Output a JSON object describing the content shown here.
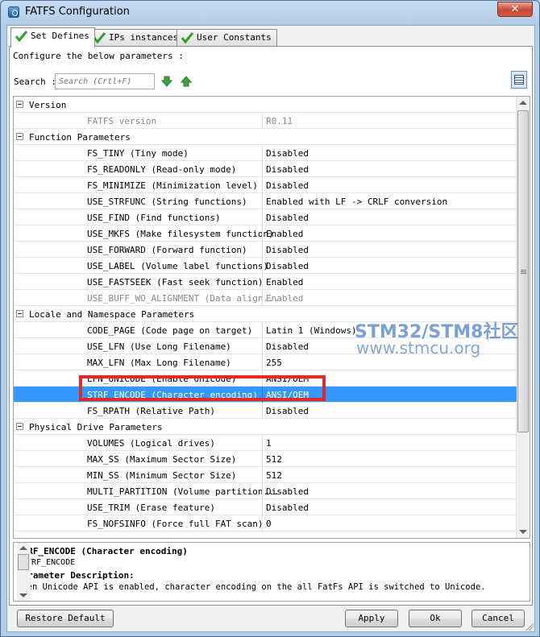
{
  "window": {
    "title": "FATFS Configuration",
    "close_label": "✕"
  },
  "tabs": [
    {
      "label": "Set Defines",
      "active": true
    },
    {
      "label": "IPs instances",
      "active": false
    },
    {
      "label": "User Constants",
      "active": false
    }
  ],
  "configure_text": "Configure the below parameters :",
  "search": {
    "label": "Search :",
    "placeholder": "Search (Crtl+F)"
  },
  "params": [
    {
      "type": "group",
      "name": "Version"
    },
    {
      "type": "param",
      "name": "FATFS version",
      "value": "R0.11",
      "disabled": true
    },
    {
      "type": "group",
      "name": "Function Parameters"
    },
    {
      "type": "param",
      "name": "FS_TINY (Tiny mode)",
      "value": "Disabled"
    },
    {
      "type": "param",
      "name": "FS_READONLY (Read-only mode)",
      "value": "Disabled"
    },
    {
      "type": "param",
      "name": "FS_MINIMIZE (Minimization level)",
      "value": "Disabled"
    },
    {
      "type": "param",
      "name": "USE_STRFUNC (String functions)",
      "value": "Enabled with LF -> CRLF conversion"
    },
    {
      "type": "param",
      "name": "USE_FIND (Find functions)",
      "value": "Disabled"
    },
    {
      "type": "param",
      "name": "USE_MKFS (Make filesystem function)",
      "value": "Enabled"
    },
    {
      "type": "param",
      "name": "USE_FORWARD (Forward function)",
      "value": "Disabled"
    },
    {
      "type": "param",
      "name": "USE_LABEL (Volume label functions)",
      "value": "Disabled"
    },
    {
      "type": "param",
      "name": "USE_FASTSEEK (Fast seek function)",
      "value": "Enabled"
    },
    {
      "type": "param",
      "name": "USE_BUFF_WO_ALIGNMENT (Data align...",
      "value": "Enabled",
      "disabled": true
    },
    {
      "type": "group",
      "name": "Locale and Namespace Parameters"
    },
    {
      "type": "param",
      "name": "CODE_PAGE (Code page on target)",
      "value": "Latin 1 (Windows)"
    },
    {
      "type": "param",
      "name": "USE_LFN (Use Long Filename)",
      "value": "Disabled"
    },
    {
      "type": "param",
      "name": "MAX_LFN (Max Long Filename)",
      "value": "255"
    },
    {
      "type": "param",
      "name": "LFN_UNICODE (Enable Unicode)",
      "value": "ANSI/OEM"
    },
    {
      "type": "param",
      "name": "STRF_ENCODE (Character encoding)",
      "value": "ANSI/OEM",
      "selected": true
    },
    {
      "type": "param",
      "name": "FS_RPATH (Relative Path)",
      "value": "Disabled"
    },
    {
      "type": "group",
      "name": "Physical Drive Parameters"
    },
    {
      "type": "param",
      "name": "VOLUMES (Logical drives)",
      "value": "1"
    },
    {
      "type": "param",
      "name": "MAX_SS (Maximum Sector Size)",
      "value": "512"
    },
    {
      "type": "param",
      "name": "MIN_SS (Minimum Sector Size)",
      "value": "512"
    },
    {
      "type": "param",
      "name": "MULTI_PARTITION (Volume partition...",
      "value": "Disabled"
    },
    {
      "type": "param",
      "name": "USE_TRIM (Erase feature)",
      "value": "Disabled"
    },
    {
      "type": "param",
      "name": "FS_NOFSINFO (Force full FAT scan)",
      "value": "0"
    }
  ],
  "details": {
    "title": "STRF_ENCODE (Character encoding)",
    "subtitle": "_STRF_ENCODE",
    "heading": "Parameter Description:",
    "text": "When Unicode API is enabled, character encoding on the all FatFs API is switched to Unicode."
  },
  "watermark": {
    "line1": "STM32/STM8社区",
    "line2": "www.stmcu.org"
  },
  "buttons": {
    "restore": "Restore Default",
    "apply": "Apply",
    "ok": "Ok",
    "cancel": "Cancel"
  }
}
